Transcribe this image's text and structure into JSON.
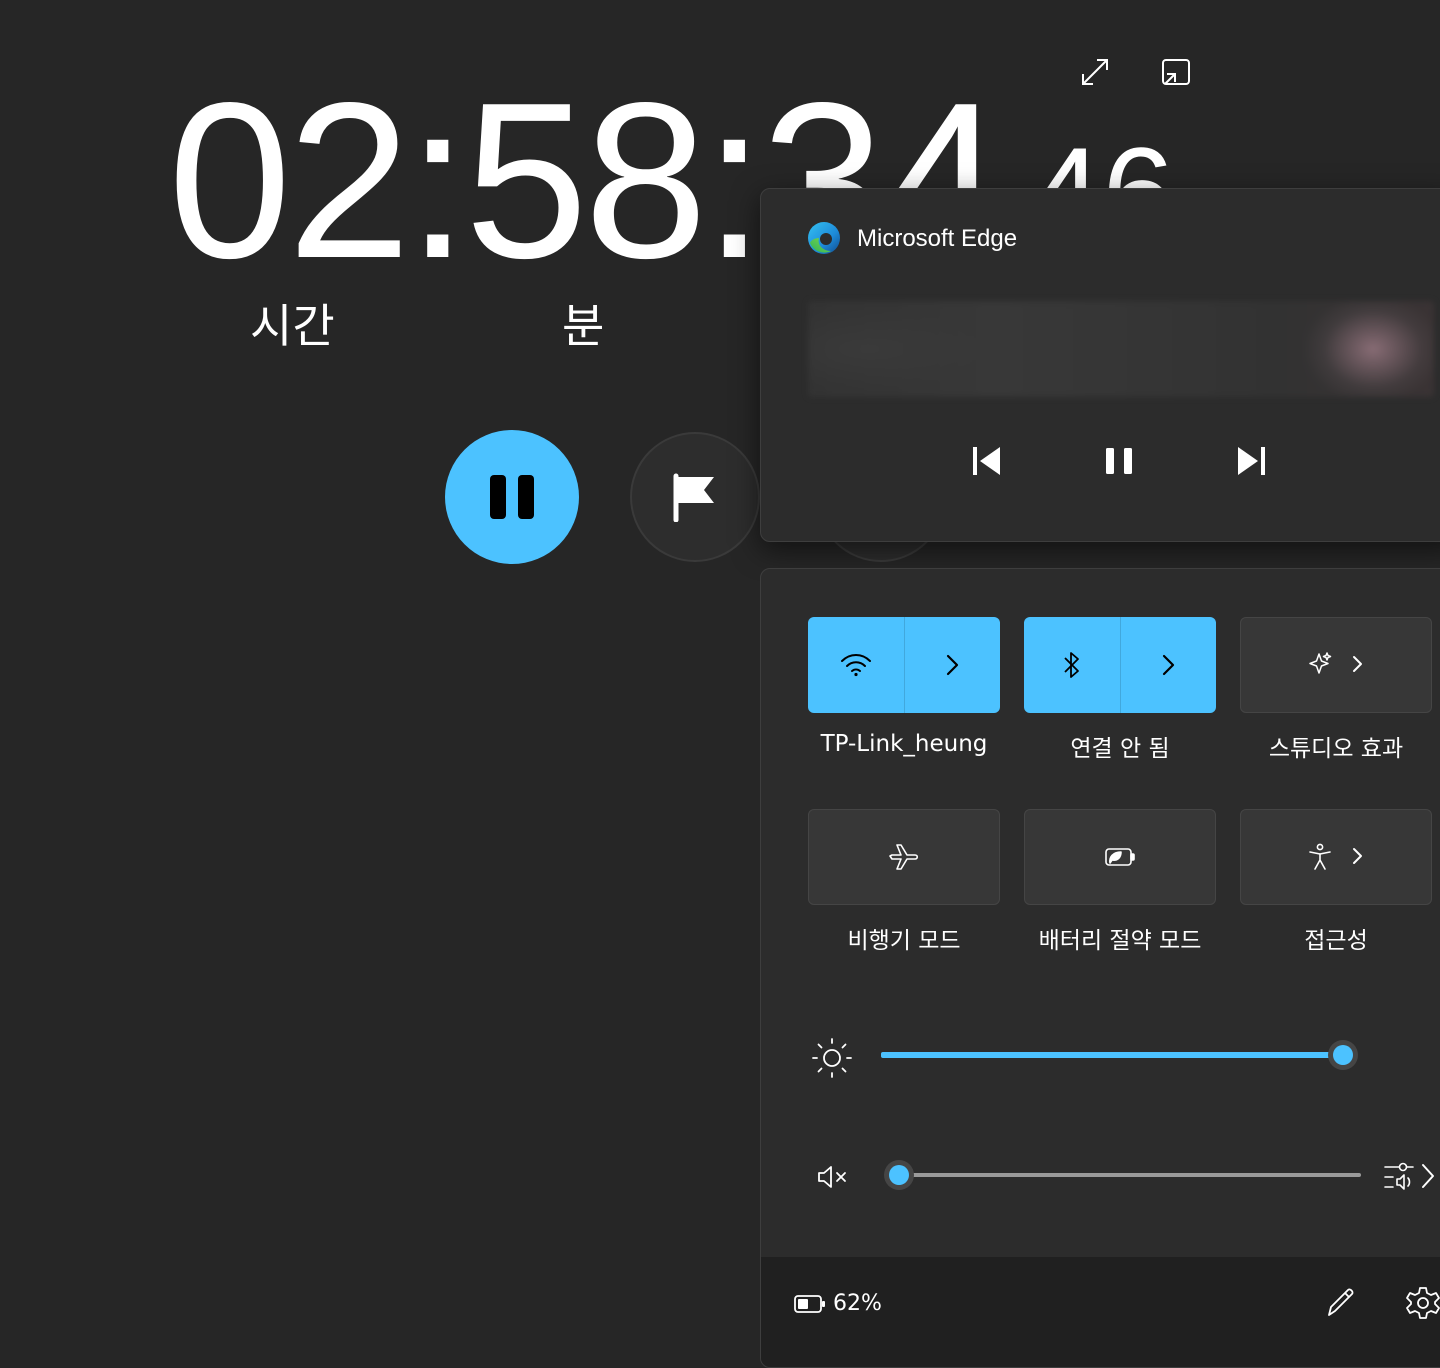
{
  "stopwatch": {
    "time_main": "02:58:34",
    "time_hundredths": "46",
    "unit_hours": "시간",
    "unit_minutes": "분",
    "icons": {
      "expand": "expand-icon",
      "compact_overlay": "compact-overlay-icon",
      "pause": "pause-icon",
      "lap": "flag-icon"
    }
  },
  "media": {
    "app_name": "Microsoft Edge",
    "app_icon": "edge-icon",
    "controls": [
      "previous-track-icon",
      "pause-icon",
      "next-track-icon"
    ]
  },
  "quick_settings": {
    "tiles": [
      {
        "label": "TP-Link_heung",
        "icon": "wifi-icon",
        "state": "on",
        "has_chevron": true
      },
      {
        "label": "연결 안 됨",
        "icon": "bluetooth-icon",
        "state": "on",
        "has_chevron": true
      },
      {
        "label": "스튜디오 효과",
        "icon": "studio-effects-icon",
        "state": "off",
        "has_chevron": true
      },
      {
        "label": "비행기 모드",
        "icon": "airplane-icon",
        "state": "off",
        "has_chevron": false
      },
      {
        "label": "배터리 절약 모드",
        "icon": "battery-saver-icon",
        "state": "off",
        "has_chevron": false
      },
      {
        "label": "접근성",
        "icon": "accessibility-icon",
        "state": "off",
        "has_chevron": true
      }
    ],
    "brightness": {
      "icon": "brightness-icon",
      "value": 100
    },
    "volume": {
      "icon": "volume-muted-icon",
      "value": 0,
      "mixer_icon": "audio-mixer-icon"
    },
    "footer": {
      "battery_icon": "battery-icon",
      "battery_percent": "62%",
      "edit_icon": "pencil-icon",
      "settings_icon": "gear-icon"
    },
    "accent_color": "#4cc2ff"
  }
}
